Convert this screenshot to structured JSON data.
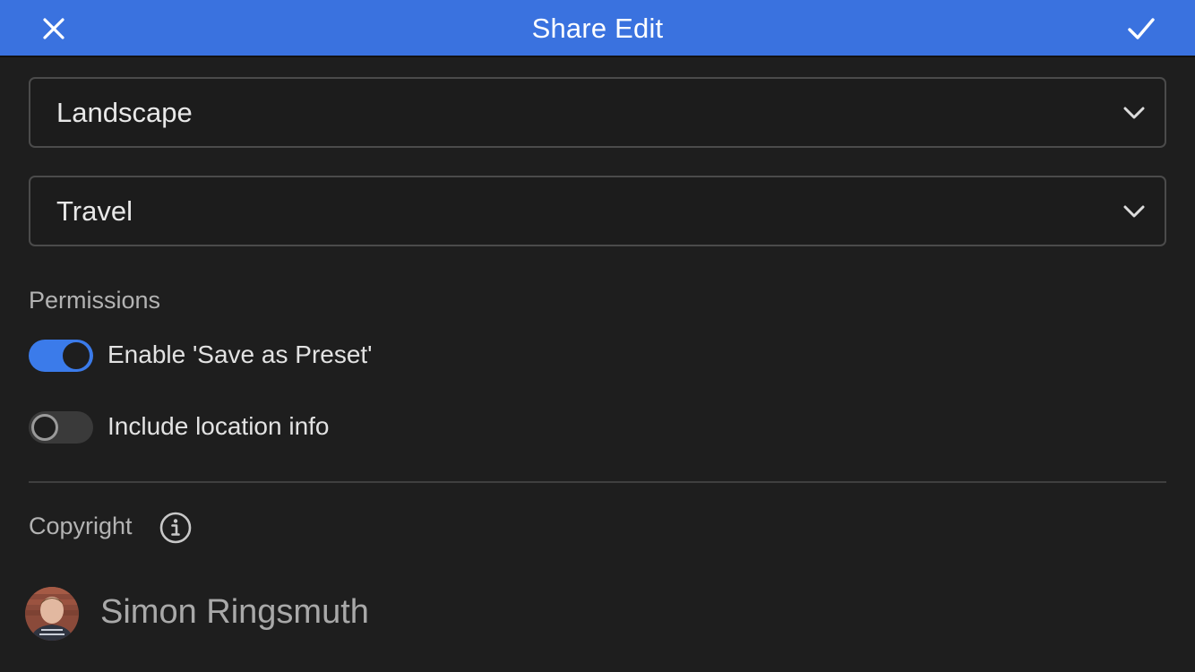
{
  "header": {
    "title": "Share Edit",
    "accent_color": "#3a72df",
    "close_icon": "close-icon",
    "confirm_icon": "checkmark-icon"
  },
  "selects": {
    "category": {
      "value": "Landscape",
      "icon": "chevron-down-icon"
    },
    "subcategory": {
      "value": "Travel",
      "icon": "chevron-down-icon"
    }
  },
  "permissions": {
    "label": "Permissions",
    "toggles": [
      {
        "label": "Enable 'Save as Preset'",
        "checked": true
      },
      {
        "label": "Include location info",
        "checked": false
      }
    ]
  },
  "copyright": {
    "label": "Copyright",
    "info_icon": "info-icon",
    "author": "Simon Ringsmuth"
  }
}
